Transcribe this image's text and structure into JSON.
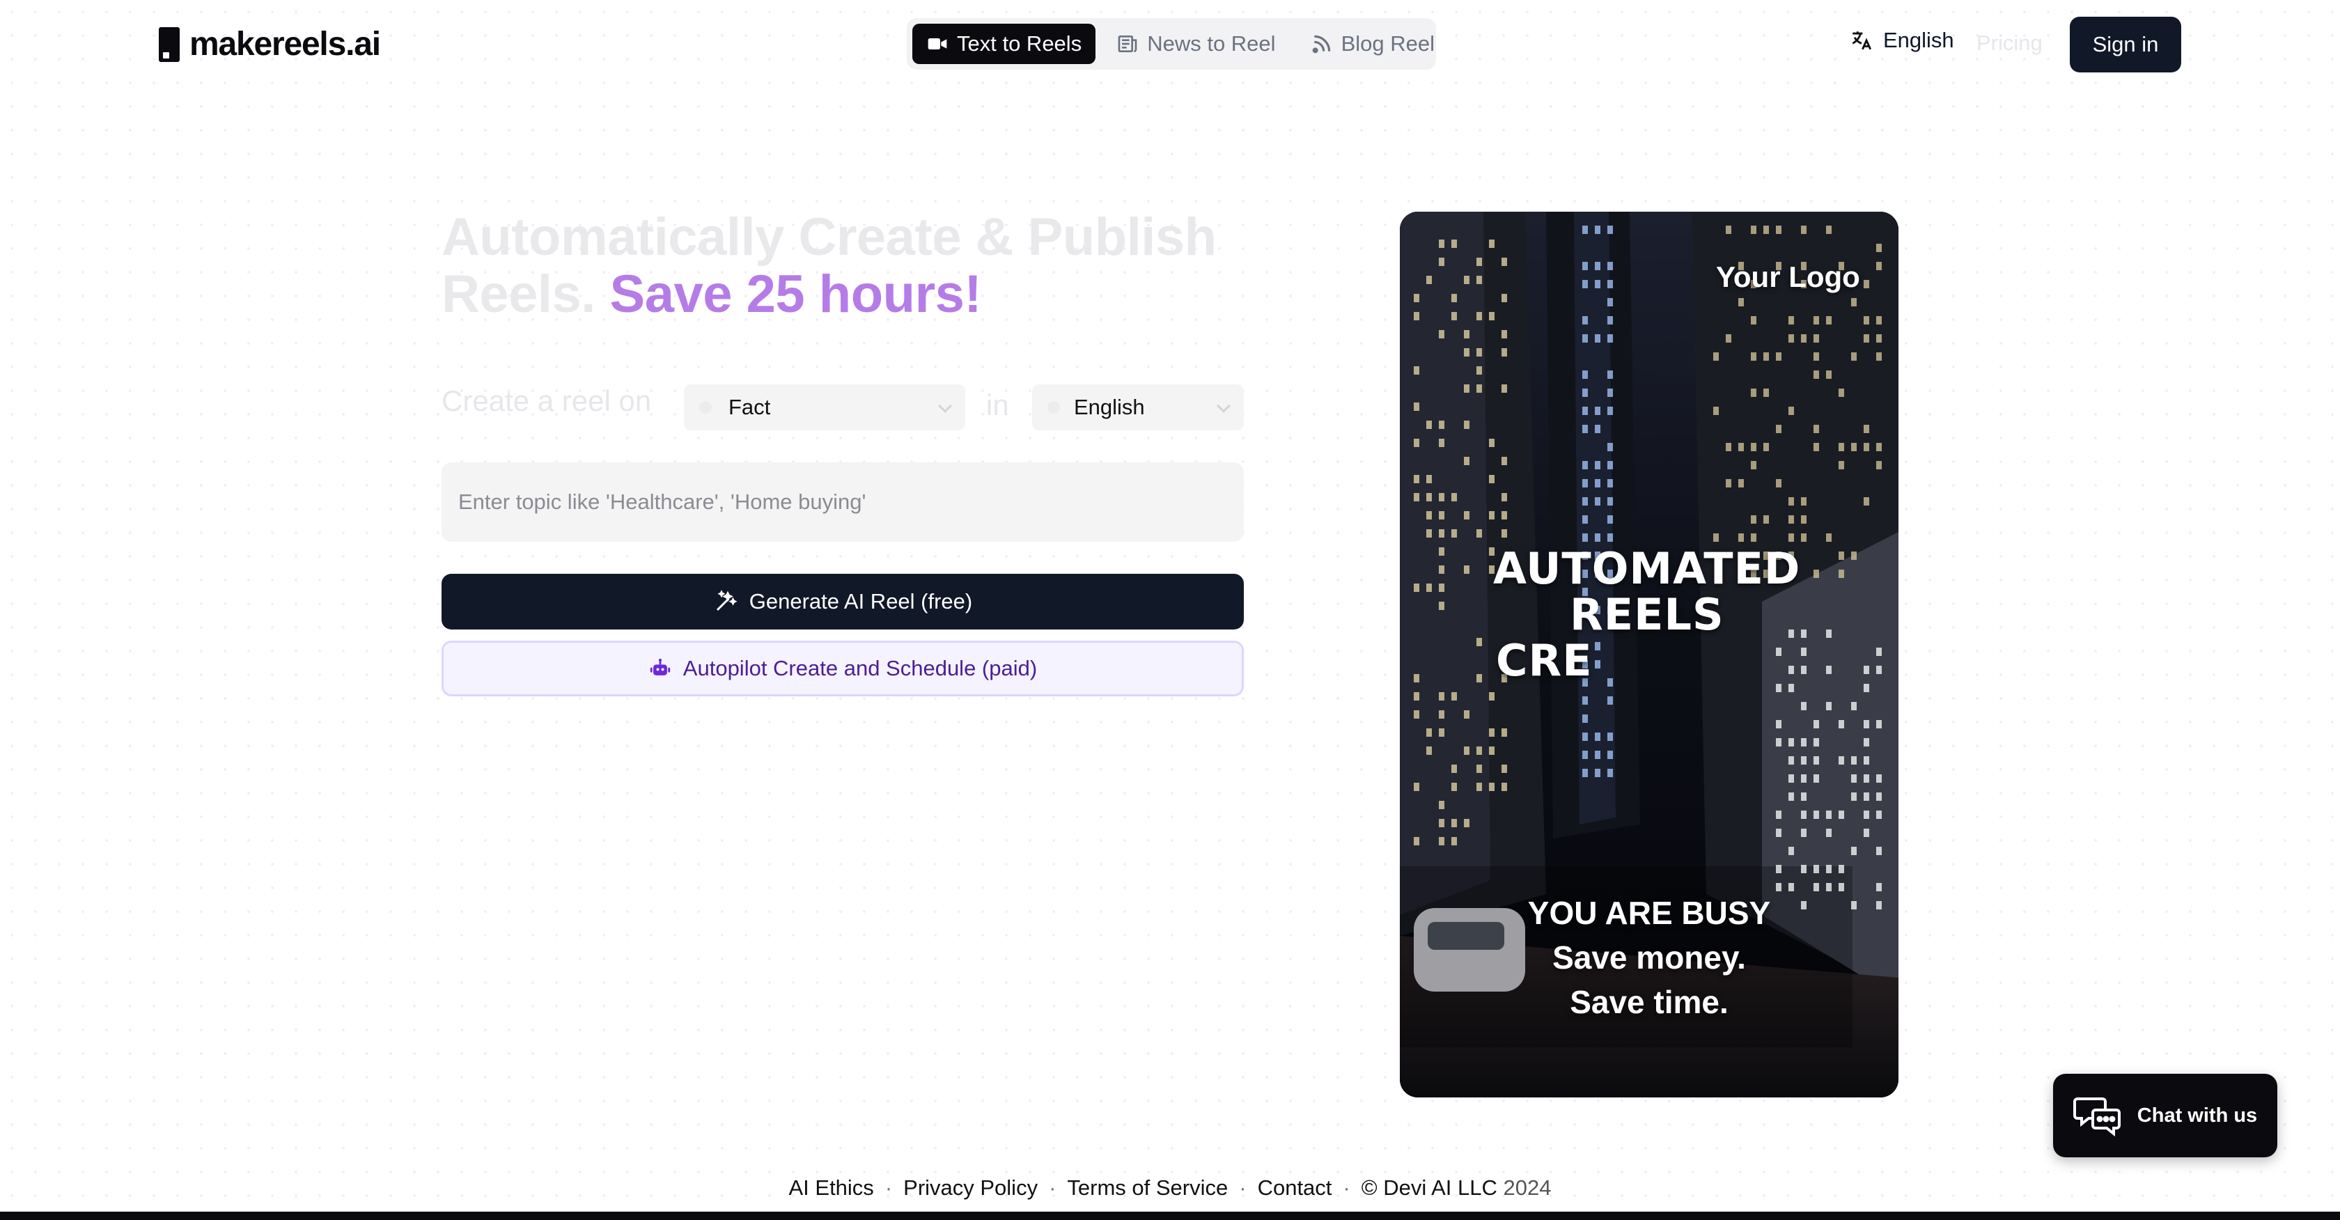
{
  "header": {
    "brand": "makereels.ai",
    "tabs": [
      {
        "label": "Text to Reels",
        "icon": "video-camera-icon",
        "active": true
      },
      {
        "label": "News to Reel",
        "icon": "newspaper-icon",
        "active": false
      },
      {
        "label": "Blog Reel",
        "icon": "rss-icon",
        "active": false
      }
    ],
    "language": "English",
    "pricing": "Pricing",
    "sign_in": "Sign in"
  },
  "hero": {
    "title_main": "Automatically Create & Publish Reels.",
    "title_accent": "Save 25 hours!",
    "accent_color": "#b57ce8",
    "prompt_label": "Create a reel on",
    "topic_value": "Fact",
    "in_label": "in",
    "language_value": "English",
    "topic_placeholder": "Enter topic like 'Healthcare', 'Home buying'",
    "generate_button": "Generate AI Reel (free)",
    "autopilot_button": "Autopilot Create and Schedule (paid)"
  },
  "video": {
    "logo_text": "Your Logo",
    "headline_line1": "AUTOMATED",
    "headline_line2": "REELS",
    "headline_line3": "CRE",
    "caption_line1": "YOU ARE BUSY",
    "caption_line2": "Save money.",
    "caption_line3": "Save time."
  },
  "chat": {
    "label": "Chat with us"
  },
  "footer": {
    "links": [
      "AI Ethics",
      "Privacy Policy",
      "Terms of Service",
      "Contact"
    ],
    "copyright": "© Devi AI LLC",
    "year": "2024"
  },
  "colors": {
    "primary_dark": "#111827",
    "accent_purple": "#b57ce8",
    "autopilot_bg": "#f5f3ff"
  }
}
